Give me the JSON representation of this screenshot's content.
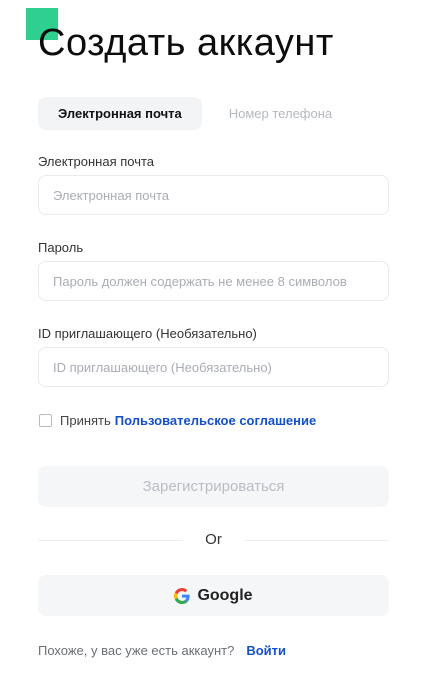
{
  "header": {
    "title": "Создать аккаунт"
  },
  "tabs": [
    {
      "label": "Электронная почта",
      "active": true
    },
    {
      "label": "Номер телефона",
      "active": false
    }
  ],
  "form": {
    "email": {
      "label": "Электронная почта",
      "placeholder": "Электронная почта",
      "value": ""
    },
    "password": {
      "label": "Пароль",
      "placeholder": "Пароль должен содержать не менее 8 символов",
      "value": ""
    },
    "referral": {
      "label": "ID приглашающего (Необязательно)",
      "placeholder": "ID приглашающего (Необязательно)",
      "value": ""
    },
    "agreement": {
      "prefix": "Принять",
      "link_text": "Пользовательское соглашение",
      "checked": false
    },
    "submit_label": "Зарегистрироваться"
  },
  "divider": {
    "text": "Or"
  },
  "social": {
    "google_label": "Google",
    "icon": "google-icon"
  },
  "footer": {
    "prompt": "Похоже, у вас уже есть аккаунт?",
    "login_label": "Войти"
  },
  "colors": {
    "accent": "#2fd08f",
    "link": "#1450c8",
    "button_bg": "#f5f6f8",
    "disabled_text": "#b9bdc4"
  }
}
